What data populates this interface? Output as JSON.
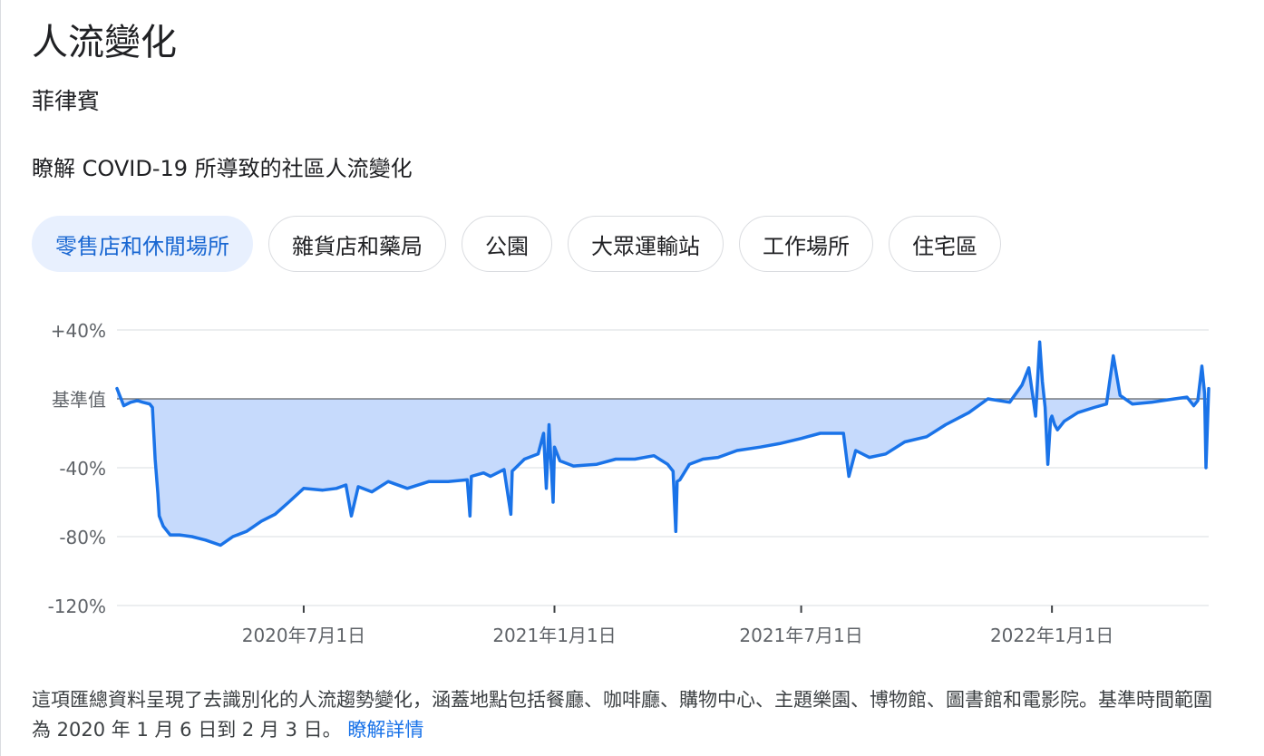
{
  "title": "人流變化",
  "region": "菲律賓",
  "subtitle": "瞭解 COVID-19 所導致的社區人流變化",
  "chips": [
    {
      "label": "零售店和休閒場所",
      "active": true
    },
    {
      "label": "雜貨店和藥局",
      "active": false
    },
    {
      "label": "公園",
      "active": false
    },
    {
      "label": "大眾運輸站",
      "active": false
    },
    {
      "label": "工作場所",
      "active": false
    },
    {
      "label": "住宅區",
      "active": false
    }
  ],
  "colors": {
    "line": "#1a73e8",
    "fill": "#c6dafc",
    "baseline": "#5f6368",
    "grid": "#dadce0",
    "active_chip_bg": "#e8f0fe",
    "active_chip_text": "#1967d2",
    "link": "#1a73e8"
  },
  "chart_data": {
    "type": "area",
    "xlabel": "",
    "ylabel": "",
    "ylim": [
      -120,
      40
    ],
    "xlim": [
      "2020-02-15",
      "2022-04-26"
    ],
    "y_ticks": [
      {
        "value": 40,
        "label": "+40%"
      },
      {
        "value": 0,
        "label": "基準值"
      },
      {
        "value": -40,
        "label": "-40%"
      },
      {
        "value": -80,
        "label": "-80%"
      },
      {
        "value": -120,
        "label": "-120%"
      }
    ],
    "x_ticks": [
      {
        "date": "2020-07-01",
        "label": "2020年7月1日"
      },
      {
        "date": "2021-01-01",
        "label": "2021年1月1日"
      },
      {
        "date": "2021-07-01",
        "label": "2021年7月1日"
      },
      {
        "date": "2022-01-01",
        "label": "2022年1月1日"
      }
    ],
    "series": [
      {
        "x": [
          "2020-02-15",
          "2020-02-20",
          "2020-02-25",
          "2020-03-01",
          "2020-03-05",
          "2020-03-10",
          "2020-03-12",
          "2020-03-14",
          "2020-03-16",
          "2020-03-17",
          "2020-03-20",
          "2020-03-25",
          "2020-04-01",
          "2020-04-10",
          "2020-04-20",
          "2020-05-01",
          "2020-05-10",
          "2020-05-20",
          "2020-05-31",
          "2020-06-10",
          "2020-06-20",
          "2020-07-01",
          "2020-07-15",
          "2020-07-25",
          "2020-08-01",
          "2020-08-05",
          "2020-08-10",
          "2020-08-20",
          "2020-09-01",
          "2020-09-15",
          "2020-10-01",
          "2020-10-15",
          "2020-10-29",
          "2020-10-31",
          "2020-11-01",
          "2020-11-10",
          "2020-11-15",
          "2020-11-25",
          "2020-11-30",
          "2020-12-01",
          "2020-12-10",
          "2020-12-20",
          "2020-12-24",
          "2020-12-26",
          "2020-12-28",
          "2020-12-31",
          "2021-01-01",
          "2021-01-05",
          "2021-01-15",
          "2021-02-01",
          "2021-02-15",
          "2021-03-01",
          "2021-03-15",
          "2021-03-25",
          "2021-03-29",
          "2021-03-31",
          "2021-04-01",
          "2021-04-03",
          "2021-04-10",
          "2021-04-20",
          "2021-05-01",
          "2021-05-15",
          "2021-06-01",
          "2021-06-15",
          "2021-07-01",
          "2021-07-15",
          "2021-08-01",
          "2021-08-05",
          "2021-08-10",
          "2021-08-20",
          "2021-09-01",
          "2021-09-15",
          "2021-10-01",
          "2021-10-15",
          "2021-11-01",
          "2021-11-15",
          "2021-12-01",
          "2021-12-10",
          "2021-12-15",
          "2021-12-20",
          "2021-12-23",
          "2021-12-25",
          "2021-12-27",
          "2021-12-29",
          "2021-12-31",
          "2022-01-01",
          "2022-01-03",
          "2022-01-05",
          "2022-01-10",
          "2022-01-20",
          "2022-02-01",
          "2022-02-10",
          "2022-02-15",
          "2022-02-20",
          "2022-03-01",
          "2022-03-15",
          "2022-04-01",
          "2022-04-10",
          "2022-04-15",
          "2022-04-18",
          "2022-04-21",
          "2022-04-23",
          "2022-04-24",
          "2022-04-26"
        ],
        "y": [
          6,
          -4,
          -2,
          -1,
          -2,
          -3,
          -5,
          -35,
          -55,
          -68,
          -74,
          -79,
          -79,
          -80,
          -82,
          -85,
          -80,
          -77,
          -71,
          -67,
          -60,
          -52,
          -53,
          -52,
          -50,
          -68,
          -51,
          -54,
          -48,
          -52,
          -48,
          -48,
          -47,
          -68,
          -45,
          -43,
          -45,
          -41,
          -67,
          -42,
          -35,
          -32,
          -20,
          -52,
          -15,
          -60,
          -28,
          -36,
          -39,
          -38,
          -35,
          -35,
          -33,
          -38,
          -42,
          -77,
          -48,
          -47,
          -38,
          -35,
          -34,
          -30,
          -28,
          -26,
          -23,
          -20,
          -20,
          -45,
          -30,
          -34,
          -32,
          -25,
          -22,
          -15,
          -8,
          0,
          -2,
          8,
          18,
          -10,
          33,
          10,
          -5,
          -38,
          -12,
          -10,
          -15,
          -18,
          -13,
          -8,
          -5,
          -3,
          25,
          2,
          -3,
          -2,
          0,
          1,
          -4,
          -1,
          19,
          3,
          -40,
          6
        ]
      }
    ]
  },
  "footnote": {
    "text": "這項匯總資料呈現了去識別化的人流趨勢變化，涵蓋地點包括餐廳、咖啡廳、購物中心、主題樂園、博物館、圖書館和電影院。基準時間範圍為 2020 年 1 月 6 日到 2 月 3 日。",
    "link": "瞭解詳情"
  }
}
